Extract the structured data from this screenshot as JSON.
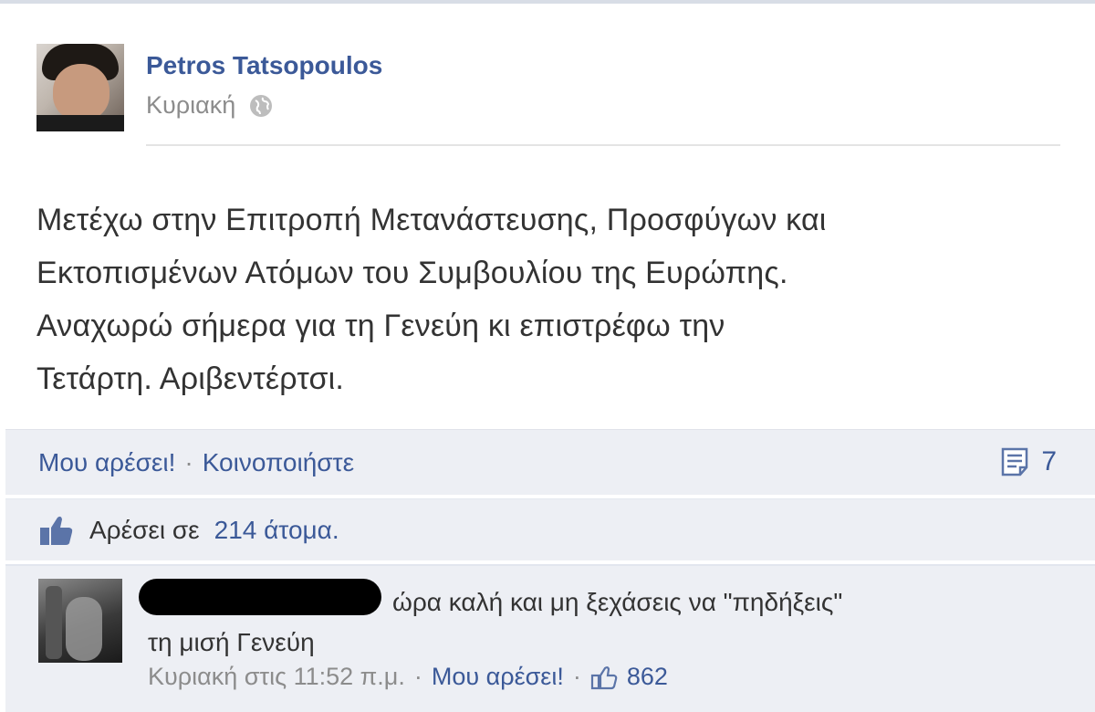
{
  "post": {
    "author_name": "Petros Tatsopoulos",
    "time": "Κυριακή",
    "privacy_icon": "globe-icon",
    "lines": [
      "Μετέχω στην Επιτροπή Μετανάστευσης, Προσφύγων και",
      "Εκτοπισμένων Ατόμων του Συμβουλίου της Ευρώπης.",
      "Αναχωρώ σήμερα για τη Γενεύη κι επιστρέφω την",
      "Τετάρτη. Αριβεντέρτσι."
    ]
  },
  "actions": {
    "like_label": "Μου αρέσει!",
    "separator": "·",
    "share_label": "Κοινοποιήστε",
    "comment_count": "7",
    "comment_icon": "comment-icon"
  },
  "likes": {
    "prefix": "Αρέσει σε",
    "count_text": "214 άτομα.",
    "icon": "thumbs-up-icon"
  },
  "comment": {
    "line1": "ώρα καλή και μη ξεχάσεις να \"πηδήξεις\"",
    "line2": "τη μισή Γενεύη",
    "time": "Κυριακή στις 11:52 π.μ.",
    "separator": "·",
    "like_label": "Μου αρέσει!",
    "like_count": "862"
  },
  "colors": {
    "link": "#3b5998",
    "meta": "#8c8c8c",
    "panel_bg": "#edeff4"
  }
}
